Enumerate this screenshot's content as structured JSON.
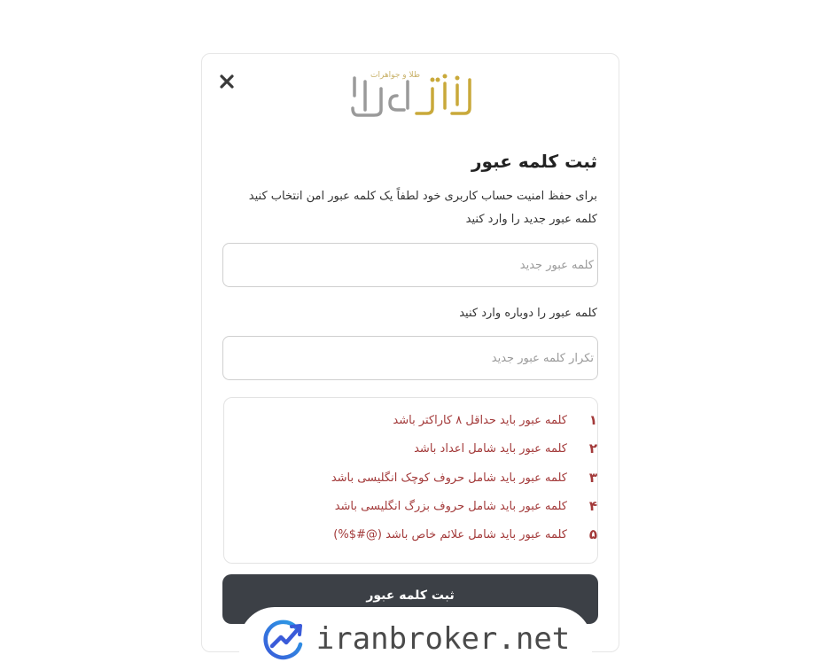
{
  "brand": {
    "logo_text": "بازار طلا",
    "logo_tagline": "طلا و جواهرات",
    "logo_color": "#c9a93a"
  },
  "dialog": {
    "close_icon": "close-icon",
    "title": "ثبت کلمه عبور",
    "description": "برای حفظ امنیت حساب کاربری خود لطفاً یک کلمه عبور امن انتخاب کنید",
    "new_password_label": "کلمه عبور جدید را وارد کنید",
    "new_password_placeholder": "کلمه عبور جدید",
    "new_password_value": "",
    "repeat_password_label": "کلمه عبور را دوباره وارد کنید",
    "repeat_password_placeholder": "تکرار کلمه عبور جدید",
    "repeat_password_value": "",
    "rules": [
      {
        "num": "۱",
        "text": "کلمه عبور باید حداقل ۸ کاراکتر باشد"
      },
      {
        "num": "۲",
        "text": "کلمه عبور باید شامل اعداد باشد"
      },
      {
        "num": "۳",
        "text": "کلمه عبور باید شامل حروف کوچک انگلیسی باشد"
      },
      {
        "num": "۴",
        "text": "کلمه عبور باید شامل حروف بزرگ انگلیسی باشد"
      },
      {
        "num": "۵",
        "text": "کلمه عبور باید شامل علائم خاص باشد (@#$%)"
      }
    ],
    "rule_color": "#a33a3a",
    "submit_label": "ثبت کلمه عبور",
    "submit_color": "#3c4046"
  },
  "watermark": {
    "text": "iranbroker.net",
    "icon": "chart-growth-icon"
  }
}
